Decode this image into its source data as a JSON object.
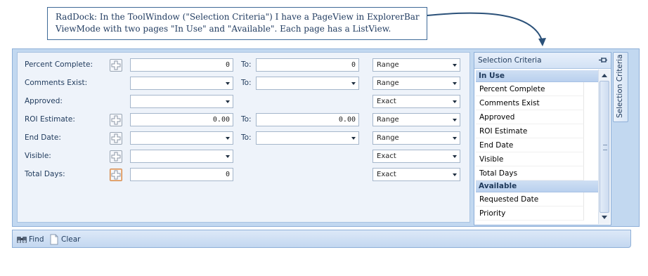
{
  "callout": {
    "line1": "RadDock: In the ToolWindow (\"Selection Criteria\") I have a PageView in ExplorerBar",
    "line2": "ViewMode with two pages \"In Use\" and \"Available\".  Each page has a ListView."
  },
  "criteria": [
    {
      "label": "Percent Complete:",
      "from": "0",
      "to_label": "To:",
      "to": "0",
      "mode": "Range"
    },
    {
      "label": "Comments Exist:",
      "from": "",
      "to_label": "To:",
      "to": "",
      "mode": "Range"
    },
    {
      "label": "Approved:",
      "from": "",
      "mode": "Exact"
    },
    {
      "label": "ROI Estimate:",
      "from": "0.00",
      "to_label": "To:",
      "to": "0.00",
      "mode": "Range"
    },
    {
      "label": "End Date:",
      "from": "",
      "to_label": "To:",
      "to": "",
      "mode": "Range"
    },
    {
      "label": "Visible:",
      "from": "",
      "mode": "Exact"
    },
    {
      "label": "Total Days:",
      "from": "0",
      "mode": "Exact"
    }
  ],
  "toolwindow": {
    "title": "Selection Criteria",
    "tab_label": "Selection Criteria",
    "pages": [
      {
        "name": "In Use",
        "items": [
          "Percent Complete",
          "Comments Exist",
          "Approved",
          "ROI Estimate",
          "End Date",
          "Visible",
          "Total Days"
        ]
      },
      {
        "name": "Available",
        "items": [
          "Requested Date",
          "Priority"
        ]
      }
    ]
  },
  "toolbar": {
    "find_label": "Find",
    "clear_label": "Clear"
  }
}
